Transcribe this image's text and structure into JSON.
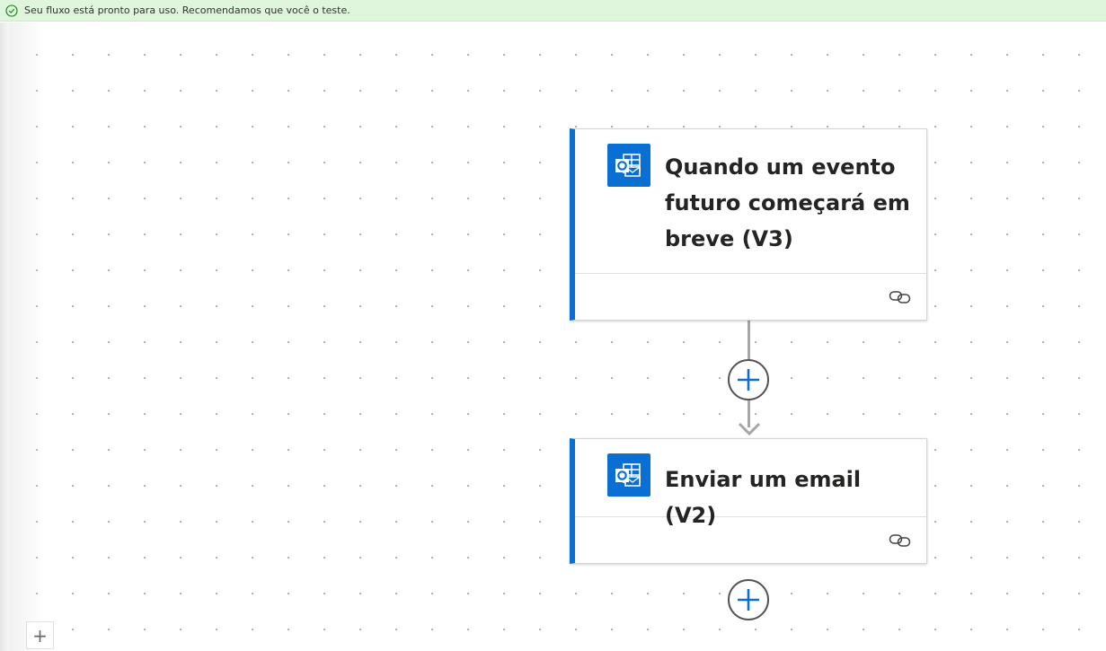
{
  "banner": {
    "message": "Seu fluxo está pronto para uso. Recomendamos que você o teste.",
    "status_color": "#107c10",
    "icon": "check-circle-icon"
  },
  "flow": {
    "accent_color": "#0a6fd2",
    "steps": [
      {
        "title": "Quando um evento futuro começará em breve (V3)",
        "connector_icon": "outlook-icon",
        "footer_icon": "link-icon"
      },
      {
        "title": "Enviar um email (V2)",
        "connector_icon": "outlook-icon",
        "footer_icon": "link-icon"
      }
    ],
    "add_step_icon": "plus-icon"
  },
  "canvas_controls": {
    "zoom_in_label": "+"
  }
}
